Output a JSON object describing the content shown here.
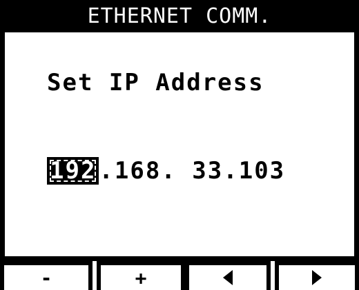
{
  "header": {
    "title": "ETHERNET COMM."
  },
  "main": {
    "prompt": "Set IP Address",
    "ip": {
      "octet1": "192",
      "sep1": ".",
      "octet2": "168",
      "sep2": ". ",
      "octet3": "33",
      "sep3": ".",
      "octet4": "103"
    },
    "selected_octet": "octet1"
  },
  "softkeys": {
    "minus_label": "-",
    "plus_label": "+",
    "left_icon": "triangle-left-icon",
    "right_icon": "triangle-right-icon"
  },
  "colors": {
    "background": "#ffffff",
    "foreground": "#000000"
  }
}
